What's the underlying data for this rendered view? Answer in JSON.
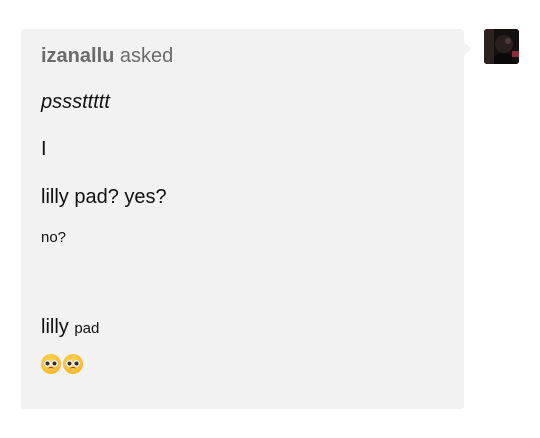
{
  "ask": {
    "asker_name": "izanallu",
    "asked_label": "asked",
    "lines": [
      "psssttttt",
      "I",
      "lilly pad? yes?",
      "no?"
    ],
    "lilly_big": "lilly",
    "lilly_small": "pad",
    "emojis": [
      "pleading-face-emoji",
      "pleading-face-emoji"
    ]
  },
  "colors": {
    "bubble_background": "#f2f2f2",
    "asker_text": "#6b6b6b",
    "body_text": "#111111"
  },
  "avatar": {
    "icon": "user-avatar-image"
  }
}
